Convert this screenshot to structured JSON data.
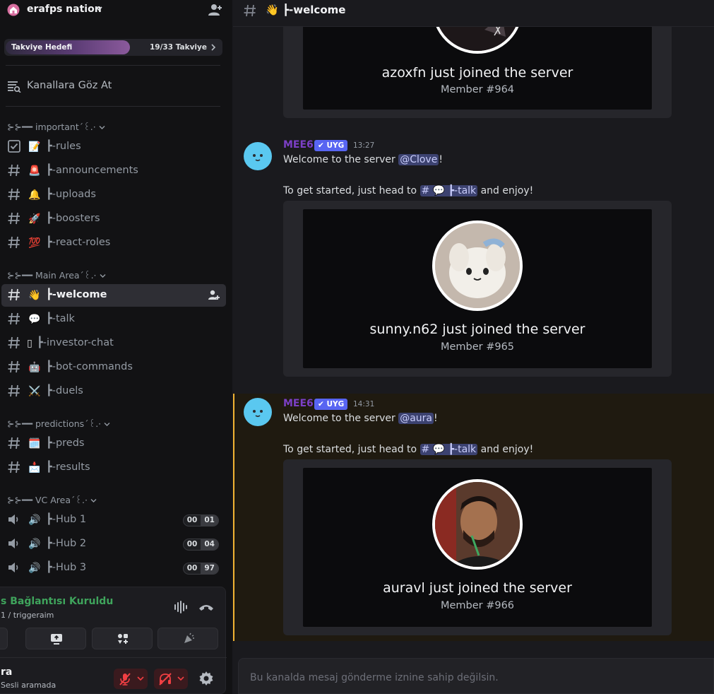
{
  "server": {
    "name": "erafps nation",
    "boost": {
      "label": "Takviye Hedefi",
      "count": "19/33 Takviye",
      "progress": 0.576
    },
    "browse_label": "Kanallara Göz At"
  },
  "sidebar": {
    "categories": [
      {
        "label": "⊱⊱━━ important´꒰.·"
      },
      {
        "label": "⊱⊱━━ Main Area´꒰.·"
      },
      {
        "label": "⊱⊱━━ predictions´꒰.·"
      },
      {
        "label": "⊱⊱━━ VC Area´꒰.·"
      }
    ],
    "channels": [
      {
        "emoji": "📝",
        "name": "┣-rules"
      },
      {
        "emoji": "🚨",
        "name": "┣-announcements"
      },
      {
        "emoji": "🔔",
        "name": "┣-uploads"
      },
      {
        "emoji": "🚀",
        "name": "┣-boosters"
      },
      {
        "emoji": "💯",
        "name": "┣-react-roles"
      },
      {
        "emoji": "👋",
        "name": "┣-welcome"
      },
      {
        "emoji": "💬",
        "name": "┣-talk"
      },
      {
        "emoji": "▯",
        "name": "┣-investor-chat"
      },
      {
        "emoji": "🤖",
        "name": "┣-bot-commands"
      },
      {
        "emoji": "⚔️",
        "name": "┣-duels"
      },
      {
        "emoji": "🗓️",
        "name": "┣-preds"
      },
      {
        "emoji": "📩",
        "name": "┣-results"
      },
      {
        "emoji": "🔊",
        "name": "┣-Hub 1",
        "left": "00",
        "right": "01"
      },
      {
        "emoji": "🔊",
        "name": "┣-Hub 2",
        "left": "00",
        "right": "04"
      },
      {
        "emoji": "🔊",
        "name": "┣-Hub 3",
        "left": "00",
        "right": "97"
      }
    ]
  },
  "voice": {
    "status": "s Bağlantısı Kuruldu",
    "sub": "1 / triggeraim",
    "user": "ra",
    "user_sub": "Sesli aramada"
  },
  "channel_header": {
    "emoji": "👋",
    "title": "┣-welcome"
  },
  "messages": [
    {
      "joined": "azoxfn just joined the server",
      "member": "Member #964"
    },
    {
      "author": "MEE6",
      "tag": "✔ UYG",
      "time": "13:27",
      "welcome_prefix": "Welcome to the server ",
      "mention": "@Clove",
      "welcome_suffix": "!",
      "start_prefix": "To get started, just head to ",
      "channel_mention": "# 💬 ┣-talk",
      "start_suffix": " and enjoy!",
      "joined": "sunny.n62 just joined the server",
      "member": "Member #965"
    },
    {
      "author": "MEE6",
      "tag": "✔ UYG",
      "time": "14:31",
      "welcome_prefix": "Welcome to the server ",
      "mention": "@aura",
      "welcome_suffix": "!",
      "start_prefix": "To get started, just head to ",
      "channel_mention": "# 💬 ┣-talk",
      "start_suffix": " and enjoy!",
      "joined": "auravl just joined the server",
      "member": "Member #966"
    }
  ],
  "composer": {
    "placeholder": "Bu kanalda mesaj gönderme iznine sahip değilsin."
  }
}
